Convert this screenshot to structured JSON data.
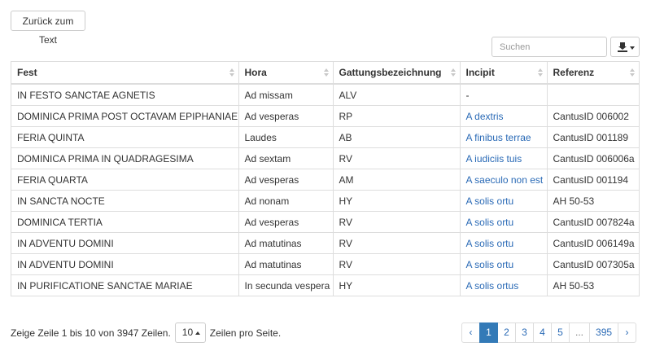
{
  "toolbar": {
    "back_label": "Zurück zum Text",
    "search_placeholder": "Suchen"
  },
  "table": {
    "columns": [
      "Fest",
      "Hora",
      "Gattungsbezeichnung",
      "Incipit",
      "Referenz"
    ],
    "rows": [
      {
        "fest": "IN FESTO SANCTAE AGNETIS",
        "hora": "Ad missam",
        "gattung": "ALV",
        "incipit": "-",
        "incipit_link": false,
        "referenz": ""
      },
      {
        "fest": "DOMINICA PRIMA POST OCTAVAM EPIPHANIAE",
        "hora": "Ad vesperas",
        "gattung": "RP",
        "incipit": "A dextris",
        "incipit_link": true,
        "referenz": "CantusID 006002"
      },
      {
        "fest": "FERIA QUINTA",
        "hora": "Laudes",
        "gattung": "AB",
        "incipit": "A finibus terrae",
        "incipit_link": true,
        "referenz": "CantusID 001189"
      },
      {
        "fest": "DOMINICA PRIMA IN QUADRAGESIMA",
        "hora": "Ad sextam",
        "gattung": "RV",
        "incipit": "A iudiciis tuis",
        "incipit_link": true,
        "referenz": "CantusID 006006a"
      },
      {
        "fest": "FERIA QUARTA",
        "hora": "Ad vesperas",
        "gattung": "AM",
        "incipit": "A saeculo non est",
        "incipit_link": true,
        "referenz": "CantusID 001194"
      },
      {
        "fest": "IN SANCTA NOCTE",
        "hora": "Ad nonam",
        "gattung": "HY",
        "incipit": "A solis ortu",
        "incipit_link": true,
        "referenz": "AH 50-53"
      },
      {
        "fest": "DOMINICA TERTIA",
        "hora": "Ad vesperas",
        "gattung": "RV",
        "incipit": "A solis ortu",
        "incipit_link": true,
        "referenz": "CantusID 007824a"
      },
      {
        "fest": "IN ADVENTU DOMINI",
        "hora": "Ad matutinas",
        "gattung": "RV",
        "incipit": "A solis ortu",
        "incipit_link": true,
        "referenz": "CantusID 006149a"
      },
      {
        "fest": "IN ADVENTU DOMINI",
        "hora": "Ad matutinas",
        "gattung": "RV",
        "incipit": "A solis ortu",
        "incipit_link": true,
        "referenz": "CantusID 007305a"
      },
      {
        "fest": "IN PURIFICATIONE SANCTAE MARIAE",
        "hora": "In secunda vespera",
        "gattung": "HY",
        "incipit": "A solis ortus",
        "incipit_link": true,
        "referenz": "AH 50-53"
      }
    ]
  },
  "footer": {
    "info_text": "Zeige Zeile 1 bis 10 von 3947 Zeilen.",
    "page_size": "10",
    "per_page_text": "Zeilen pro Seite."
  },
  "pagination": {
    "prev": "‹",
    "pages": [
      "1",
      "2",
      "3",
      "4",
      "5",
      "...",
      "395"
    ],
    "active": "1",
    "next": "›"
  },
  "colors": {
    "link": "#2a6ab6",
    "active_page_bg": "#337ab7",
    "border": "#dddddd"
  },
  "icons": {
    "export": "export-icon",
    "sort": "sort-icon"
  }
}
